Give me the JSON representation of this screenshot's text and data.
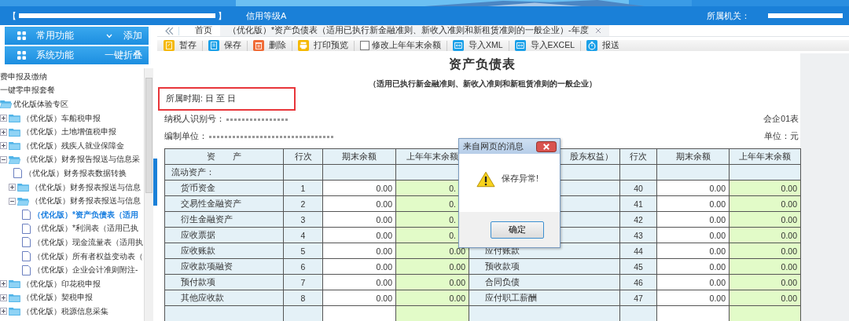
{
  "header": {
    "bracket_open": "【",
    "bracket_close": "】",
    "credit": "信用等级A",
    "authority_label": "所属机关："
  },
  "menus": [
    {
      "label": "常用功能",
      "action": "添加",
      "caret": true
    },
    {
      "label": "系统功能",
      "action": "一键折叠",
      "caret": false
    }
  ],
  "tree": [
    {
      "label": "费申报及缴纳",
      "kind": "text"
    },
    {
      "label": "一键零申报套餐",
      "kind": "text"
    },
    {
      "label": "优化版体验专区",
      "kind": "folder",
      "expanded": true,
      "children": [
        {
          "label": "（优化版）车船税申报",
          "kind": "folder",
          "expanded": false
        },
        {
          "label": "（优化版）土地增值税申报",
          "kind": "folder",
          "expanded": false
        },
        {
          "label": "（优化版）残疾人就业保障金",
          "kind": "folder",
          "expanded": false
        },
        {
          "label": "（优化版）财务报告报送与信息采",
          "kind": "folder",
          "expanded": true,
          "children": [
            {
              "label": "（优化版）财务报表数据转换",
              "kind": "document"
            },
            {
              "label": "（优化版）财务报表报送与信息",
              "kind": "folder",
              "expanded": false
            },
            {
              "label": "（优化版）财务报表报送与信息",
              "kind": "folder",
              "expanded": true,
              "children": [
                {
                  "label": "（优化版）*资产负债表（适用",
                  "kind": "document",
                  "selected": true
                },
                {
                  "label": "（优化版）*利润表（适用已执",
                  "kind": "document",
                  "selected": false
                },
                {
                  "label": "（优化版）现金流量表（适用执",
                  "kind": "document",
                  "selected": false
                },
                {
                  "label": "（优化版）所有者权益变动表（",
                  "kind": "document",
                  "selected": false
                },
                {
                  "label": "（优化版）企业会计准则附注-",
                  "kind": "document",
                  "selected": false
                }
              ]
            }
          ]
        },
        {
          "label": "（优化版）印花税申报",
          "kind": "folder",
          "expanded": false
        },
        {
          "label": "（优化版）契税申报",
          "kind": "folder",
          "expanded": false
        },
        {
          "label": "（优化版）税源信息采集",
          "kind": "folder",
          "expanded": false
        }
      ]
    }
  ],
  "tabs": [
    {
      "label": "首页",
      "selected": false,
      "closable": false
    },
    {
      "label": "（优化版）*资产负债表（适用已执行新金融准则、新收入准则和新租赁准则的一般企业）-年度",
      "selected": true,
      "closable": true
    }
  ],
  "toolbar": [
    {
      "kind": "button",
      "label": "暂存",
      "color": "#f5b800"
    },
    {
      "kind": "button",
      "label": "保存",
      "color": "#1aa0e8"
    },
    {
      "kind": "button",
      "label": "删除",
      "color": "#f06a35"
    },
    {
      "kind": "button",
      "label": "打印预览",
      "color": "#f5b800"
    },
    {
      "kind": "checkbox",
      "label": "修改上年年末余额",
      "checked": false
    },
    {
      "kind": "button",
      "label": "导入XML",
      "color": "#1aa0e8"
    },
    {
      "kind": "button",
      "label": "导入EXCEL",
      "color": "#1aa0e8"
    },
    {
      "kind": "button",
      "label": "报送",
      "color": "#1aa0e8"
    }
  ],
  "form": {
    "title": "资产负债表",
    "subtitle": "（适用已执行新金融准则、新收入准则和新租赁准则的一般企业）",
    "period": "所属时期: 日 至 日",
    "taxpayer_label": "纳税人识别号：",
    "unit_label": "编制单位：",
    "form_code": "会企01表",
    "currency": "单位：元",
    "columns": [
      "资　　产",
      "行次",
      "期末余额",
      "上年年末余额",
      "股东权益）",
      "行次",
      "期末余额",
      "上年年末余额"
    ],
    "rows": [
      {
        "kind": "section",
        "asset": "流动资产："
      },
      {
        "kind": "item",
        "asset": "货币资金",
        "line": "1",
        "end": "0.00",
        "prior": "0.",
        "under_dialog": true,
        "line2": "40",
        "end2": "0.00",
        "prior2": "0.00"
      },
      {
        "kind": "item",
        "asset": "交易性金融资产",
        "line": "2",
        "end": "0.00",
        "prior": "0.",
        "under_dialog": true,
        "line2": "41",
        "end2": "0.00",
        "prior2": "0.00"
      },
      {
        "kind": "item",
        "asset": "衍生金融资产",
        "line": "3",
        "end": "0.00",
        "prior": "0.",
        "under_dialog": true,
        "line2": "42",
        "end2": "0.00",
        "prior2": "0.00"
      },
      {
        "kind": "item",
        "asset": "应收票据",
        "line": "4",
        "end": "0.00",
        "prior": "0.",
        "under_dialog": true,
        "line2": "43",
        "end2": "0.00",
        "prior2": "0.00"
      },
      {
        "kind": "item",
        "asset": "应收账款",
        "line": "5",
        "end": "0.00",
        "prior": "0.00",
        "under_dialog": false,
        "liability": "应付账款",
        "line2": "44",
        "end2": "0.00",
        "prior2": "0.00"
      },
      {
        "kind": "item",
        "asset": "应收款项融资",
        "line": "6",
        "end": "0.00",
        "prior": "0.00",
        "under_dialog": false,
        "liability": "预收款项",
        "line2": "45",
        "end2": "0.00",
        "prior2": "0.00"
      },
      {
        "kind": "item",
        "asset": "预付款项",
        "line": "7",
        "end": "0.00",
        "prior": "0.00",
        "under_dialog": false,
        "liability": "合同负债",
        "line2": "46",
        "end2": "0.00",
        "prior2": "0.00"
      },
      {
        "kind": "item",
        "asset": "其他应收款",
        "line": "8",
        "end": "0.00",
        "prior": "0.00",
        "under_dialog": false,
        "liability": "应付职工薪酬",
        "line2": "47",
        "end2": "0.00",
        "prior2": "0.00"
      },
      {
        "kind": "partial"
      }
    ]
  },
  "dialog": {
    "title": "来自网页的消息",
    "message": "保存异常!",
    "button": "确定"
  }
}
